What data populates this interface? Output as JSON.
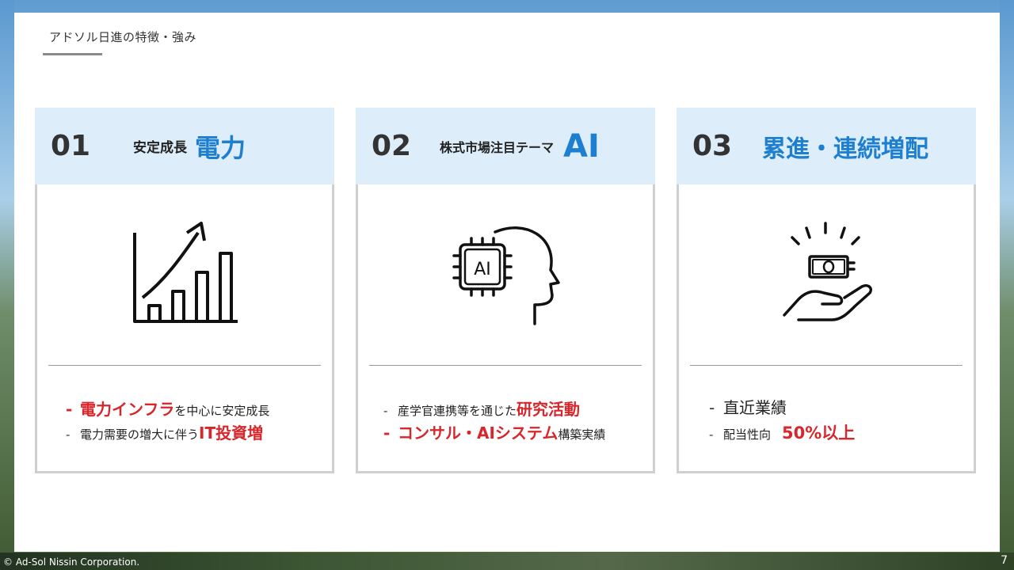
{
  "slide": {
    "title": "アドソル日進の特徴・強み"
  },
  "cards": [
    {
      "num": "01",
      "subtitle": "安定成長",
      "keyword": "電力",
      "icon": "growth-chart-icon",
      "bullets": [
        {
          "dash": "-",
          "red": "電力インフラ",
          "rest": "を中心に安定成長"
        },
        {
          "dash": "-",
          "text": "電力需要の増大に伴う",
          "red": "IT投資増"
        }
      ]
    },
    {
      "num": "02",
      "subtitle": "株式市場注目テーマ",
      "keyword": "AI",
      "icon": "ai-brain-icon",
      "chip_label": "AI",
      "bullets": [
        {
          "dash": "-",
          "text": "産学官連携等を通じた",
          "red": "研究活動"
        },
        {
          "dash": "-",
          "red": "コンサル・AIシステム",
          "rest": "構築実績"
        }
      ]
    },
    {
      "num": "03",
      "subtitle": "",
      "keyword": "累進・連続増配",
      "icon": "money-hand-icon",
      "bullets": [
        {
          "dash": "-",
          "text": "直近業績"
        },
        {
          "dash": "-",
          "text": "配当性向",
          "red": "50%以上"
        }
      ]
    }
  ],
  "footer": {
    "copyright": "© Ad-Sol Nissin Corporation.",
    "page": "7"
  },
  "colors": {
    "accent_blue": "#1e7fd0",
    "accent_red": "#d8262b",
    "head_bg": "#ddeefa"
  }
}
